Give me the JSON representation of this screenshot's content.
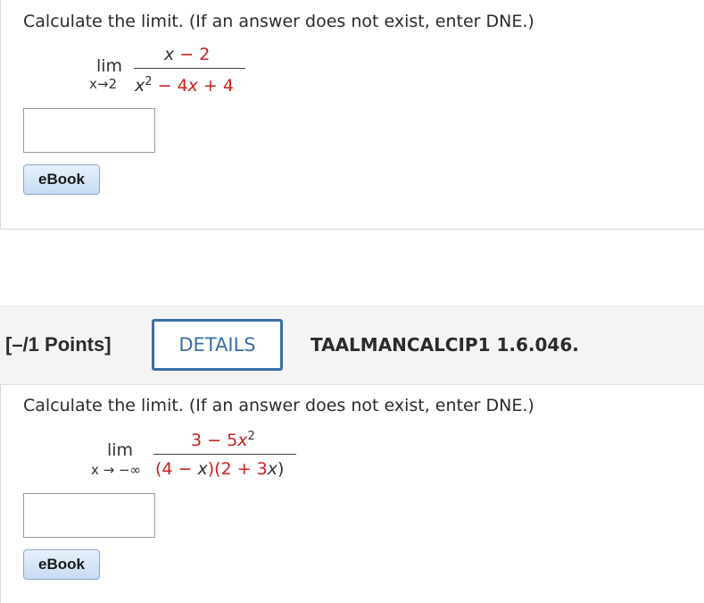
{
  "question1": {
    "prompt": "Calculate the limit. (If an answer does not exist, enter DNE.)",
    "lim": "lim",
    "subscript": "x→2",
    "numerator": [
      "x",
      " − 2"
    ],
    "denominator": [
      "x",
      "2",
      " − 4",
      "x",
      " + 4"
    ],
    "answer_value": "",
    "ebook_label": "eBook"
  },
  "question2": {
    "points": "[–/1 Points]",
    "details_label": "DETAILS",
    "reference": "TAALMANCALCIP1 1.6.046.",
    "prompt": "Calculate the limit. (If an answer does not exist, enter DNE.)",
    "lim": "lim",
    "subscript": "x → −∞",
    "numerator": [
      "3 − 5",
      "x",
      "2"
    ],
    "denominator": [
      "(4 − ",
      "x",
      ")(2 + 3",
      "x",
      ")"
    ],
    "answer_value": "",
    "ebook_label": "eBook"
  },
  "colors": {
    "accent": "#3a6ea5",
    "math_red": "#cc1f1f"
  }
}
